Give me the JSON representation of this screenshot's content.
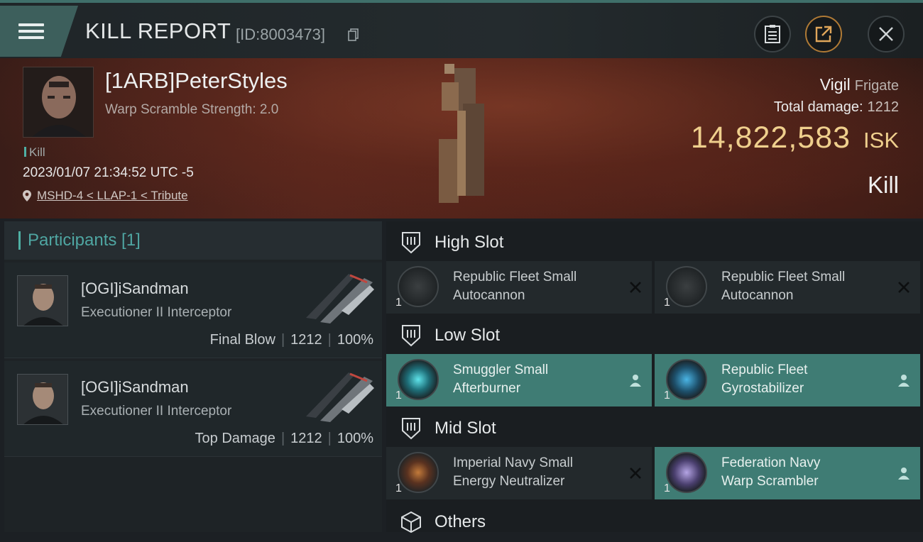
{
  "header": {
    "title": "KILL REPORT",
    "report_id": "[ID:8003473]",
    "icons": [
      "menu-icon",
      "copy-icon",
      "clipboard-icon",
      "share-icon",
      "close-icon"
    ]
  },
  "victim": {
    "name": "[1ARB]PeterStyles",
    "detail": "Warp Scramble Strength: 2.0",
    "tag": "Kill",
    "datetime": "2023/01/07 21:34:52 UTC -5",
    "location": "MSHD-4 < LLAP-1 < Tribute",
    "ship_name": "Vigil",
    "ship_class": "Frigate",
    "total_damage_label": "Total damage:",
    "total_damage": "1212",
    "isk_value": "14,822,583",
    "isk_unit": "ISK",
    "result": "Kill"
  },
  "participants": {
    "title": "Participants [1]",
    "rows": [
      {
        "name": "[OGI]iSandman",
        "ship": "Executioner II Interceptor",
        "role": "Final Blow",
        "damage": "1212",
        "percent": "100%"
      },
      {
        "name": "[OGI]iSandman",
        "ship": "Executioner II Interceptor",
        "role": "Top Damage",
        "damage": "1212",
        "percent": "100%"
      }
    ]
  },
  "slots": {
    "high": {
      "label": "High Slot",
      "modules": [
        {
          "line1": "Republic Fleet Small",
          "line2": "Autocannon",
          "qty": "1",
          "status": "destroyed"
        },
        {
          "line1": "Republic Fleet Small",
          "line2": "Autocannon",
          "qty": "1",
          "status": "destroyed"
        }
      ]
    },
    "low": {
      "label": "Low Slot",
      "modules": [
        {
          "line1": "Smuggler Small",
          "line2": "Afterburner",
          "qty": "1",
          "status": "dropped"
        },
        {
          "line1": "Republic Fleet",
          "line2": "Gyrostabilizer",
          "qty": "1",
          "status": "dropped"
        }
      ]
    },
    "mid": {
      "label": "Mid Slot",
      "modules": [
        {
          "line1": "Imperial Navy Small",
          "line2": "Energy Neutralizer",
          "qty": "1",
          "status": "destroyed"
        },
        {
          "line1": "Federation Navy",
          "line2": "Warp Scrambler",
          "qty": "1",
          "status": "dropped"
        }
      ]
    },
    "others": {
      "label": "Others"
    }
  },
  "colors": {
    "accent_teal": "#4fb0a4",
    "dropped_bg": "#3f7c74",
    "isk_gold": "#efcf8d",
    "banner_red": "#55261d"
  }
}
